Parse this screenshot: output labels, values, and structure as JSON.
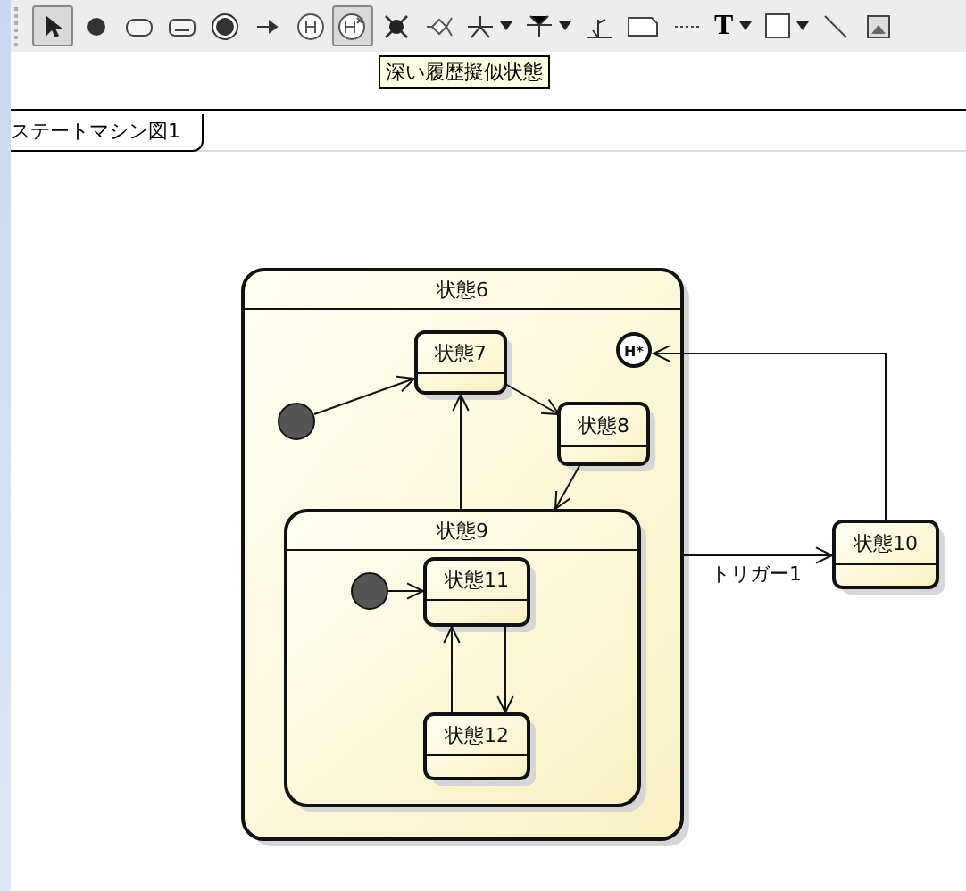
{
  "toolbar": {
    "tools": [
      {
        "kind": "select",
        "selected": true,
        "dropdown": false
      },
      {
        "kind": "initial",
        "selected": false,
        "dropdown": false
      },
      {
        "kind": "state",
        "selected": false,
        "dropdown": false
      },
      {
        "kind": "submachine",
        "selected": false,
        "dropdown": false
      },
      {
        "kind": "final",
        "selected": false,
        "dropdown": false
      },
      {
        "kind": "transition",
        "selected": false,
        "dropdown": false
      },
      {
        "kind": "history",
        "selected": false,
        "dropdown": false
      },
      {
        "kind": "deep-history",
        "selected": true,
        "dropdown": false
      },
      {
        "kind": "terminate",
        "selected": false,
        "dropdown": false
      },
      {
        "kind": "choice",
        "selected": false,
        "dropdown": false
      },
      {
        "kind": "fork",
        "selected": false,
        "dropdown": true
      },
      {
        "kind": "join",
        "selected": false,
        "dropdown": true
      },
      {
        "kind": "anchor",
        "selected": false,
        "dropdown": false
      },
      {
        "kind": "note",
        "selected": false,
        "dropdown": false
      },
      {
        "kind": "dotted",
        "selected": false,
        "dropdown": false
      },
      {
        "kind": "text",
        "label": "T",
        "selected": false,
        "dropdown": true
      },
      {
        "kind": "rect",
        "selected": false,
        "dropdown": true
      },
      {
        "kind": "line",
        "selected": false,
        "dropdown": false
      },
      {
        "kind": "image",
        "selected": false,
        "dropdown": false
      }
    ]
  },
  "tooltip": "深い履歴擬似状態",
  "tab": {
    "label": "ステートマシン図1"
  },
  "diagram": {
    "states": [
      {
        "name": "状態6",
        "children": [
          {
            "name": "状態7"
          },
          {
            "name": "状態8"
          },
          {
            "name": "状態9",
            "children": [
              {
                "name": "状態11"
              },
              {
                "name": "状態12"
              }
            ]
          }
        ]
      },
      {
        "name": "状態10"
      }
    ],
    "history_label": "H*",
    "transitions": [
      {
        "label": "トリガー1"
      }
    ]
  }
}
